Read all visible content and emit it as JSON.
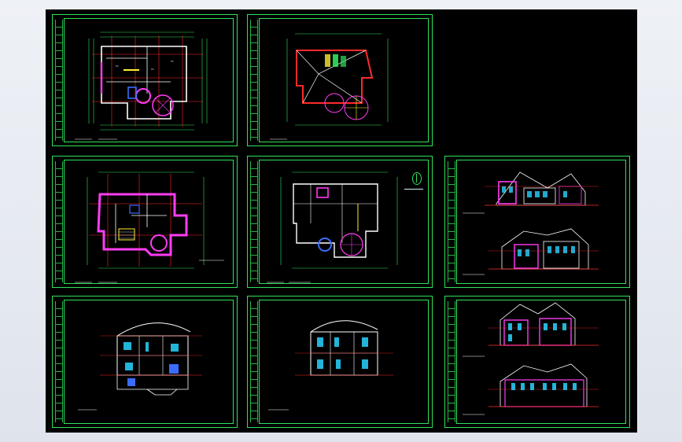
{
  "viewer": {
    "background": "#000000",
    "sheet_color": "#2fe25a"
  },
  "sheets": [
    {
      "id": "first-floor-plan",
      "kind": "plan"
    },
    {
      "id": "roof-plan",
      "kind": "roof"
    },
    {
      "id": "basement-plan",
      "kind": "plan"
    },
    {
      "id": "second-floor-plan",
      "kind": "plan"
    },
    {
      "id": "elevations-a",
      "kind": "elevations"
    },
    {
      "id": "section-1",
      "kind": "section"
    },
    {
      "id": "section-2",
      "kind": "section"
    },
    {
      "id": "elevations-b",
      "kind": "elevations"
    }
  ],
  "colors": {
    "wall": "#ff3df2",
    "dimension": "#2fe25a",
    "axis": "#ff2a2a",
    "text": "#ffffff",
    "accent_cyan": "#2ad4ff",
    "accent_yellow": "#ffee33",
    "accent_blue": "#3b6bff"
  }
}
